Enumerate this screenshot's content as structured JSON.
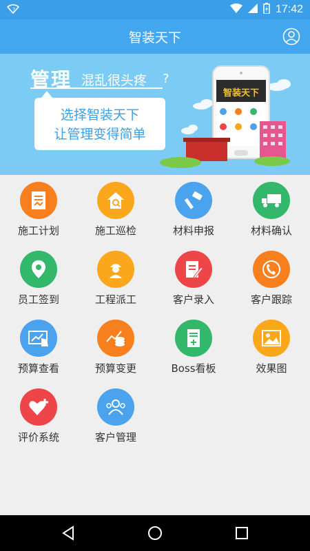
{
  "status": {
    "time": "17:42",
    "left_icon": "wifi-question-icon"
  },
  "appbar": {
    "title": "智装天下",
    "user_icon": "user-circle-icon"
  },
  "banner": {
    "headline": "管理",
    "headline_sub": "混乱很头疼",
    "question": "?",
    "line1": "选择智装天下",
    "line2": "让管理变得简单",
    "phone_text": "智装天下"
  },
  "grid": {
    "items": [
      {
        "label": "施工计划",
        "color": "#f77f1e",
        "icon": "document-icon"
      },
      {
        "label": "施工巡检",
        "color": "#fba71b",
        "icon": "house-search-icon"
      },
      {
        "label": "材料申报",
        "color": "#4aa3ec",
        "icon": "tools-icon"
      },
      {
        "label": "材料确认",
        "color": "#33b86b",
        "icon": "truck-icon"
      },
      {
        "label": "员工签到",
        "color": "#33b86b",
        "icon": "location-pin-icon"
      },
      {
        "label": "工程派工",
        "color": "#fba71b",
        "icon": "worker-icon"
      },
      {
        "label": "客户录入",
        "color": "#ee4548",
        "icon": "edit-document-icon"
      },
      {
        "label": "客户跟踪",
        "color": "#f77f1e",
        "icon": "phone-customer-icon"
      },
      {
        "label": "预算查看",
        "color": "#4aa3ec",
        "icon": "screen-touch-icon"
      },
      {
        "label": "预算变更",
        "color": "#f77f1e",
        "icon": "coins-chart-icon"
      },
      {
        "label": "Boss看板",
        "color": "#33b86b",
        "icon": "board-plus-icon"
      },
      {
        "label": "效果图",
        "color": "#fba71b",
        "icon": "image-icon"
      },
      {
        "label": "评价系统",
        "color": "#ee4548",
        "icon": "heart-plus-icon"
      },
      {
        "label": "客户管理",
        "color": "#4aa3ec",
        "icon": "group-icon"
      }
    ]
  },
  "navbar": {
    "back": "back-triangle-icon",
    "home": "home-circle-icon",
    "recents": "recents-square-icon"
  }
}
